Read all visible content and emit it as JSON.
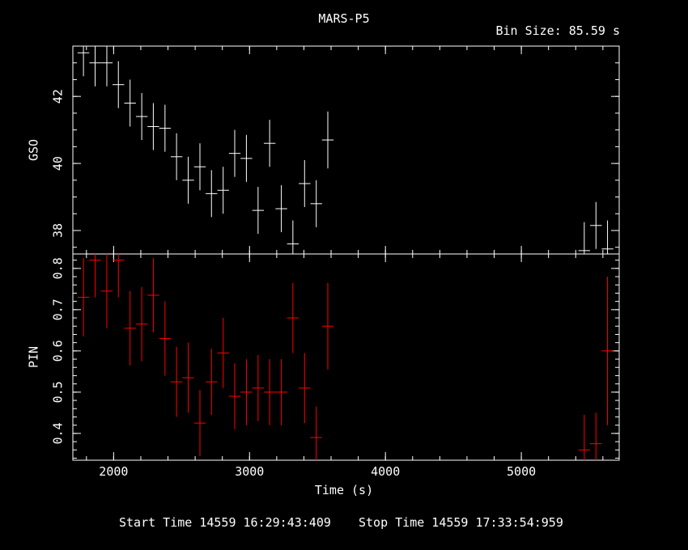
{
  "title": "MARS-P5",
  "bin_size": "Bin Size: 85.59 s",
  "start_time": "Start Time 14559 16:29:43:409",
  "stop_time": "Stop Time 14559 17:33:54:959",
  "colors": {
    "background": "#000000",
    "axes": "#ffffff",
    "gso": "#ffffff",
    "pin": "#ff0000"
  },
  "chart_data": [
    {
      "type": "scatter",
      "panel": "top",
      "ylabel": "GSO",
      "xlim": [
        1700,
        5720
      ],
      "ylim": [
        37.3,
        43.5
      ],
      "yticks": [
        38,
        40,
        42
      ],
      "ytick_labels": [
        "38",
        "40",
        "42"
      ],
      "minor_ystep": 0.5,
      "x_halfwidth": 42.8,
      "series": [
        {
          "color": "#ffffff",
          "points": [
            [
              1778,
              43.3,
              0.7
            ],
            [
              1864,
              43.0,
              0.7
            ],
            [
              1950,
              43.0,
              0.7
            ],
            [
              2035,
              42.35,
              0.7
            ],
            [
              2121,
              41.8,
              0.7
            ],
            [
              2207,
              41.4,
              0.7
            ],
            [
              2292,
              41.1,
              0.7
            ],
            [
              2378,
              41.05,
              0.7
            ],
            [
              2463,
              40.2,
              0.7
            ],
            [
              2549,
              39.5,
              0.7
            ],
            [
              2635,
              39.9,
              0.7
            ],
            [
              2720,
              39.1,
              0.7
            ],
            [
              2806,
              39.2,
              0.7
            ],
            [
              2891,
              40.3,
              0.7
            ],
            [
              2977,
              40.15,
              0.7
            ],
            [
              3063,
              38.6,
              0.7
            ],
            [
              3148,
              40.6,
              0.7
            ],
            [
              3234,
              38.65,
              0.7
            ],
            [
              3319,
              37.6,
              0.7
            ],
            [
              3405,
              39.4,
              0.7
            ],
            [
              3491,
              38.8,
              0.7
            ],
            [
              3576,
              40.7,
              0.85
            ],
            [
              5463,
              37.4,
              0.85
            ],
            [
              5549,
              38.15,
              0.7
            ],
            [
              5634,
              37.45,
              0.85
            ]
          ]
        }
      ]
    },
    {
      "type": "scatter",
      "panel": "bottom",
      "ylabel": "PIN",
      "xlabel": "Time (s)",
      "xlim": [
        1700,
        5720
      ],
      "ylim": [
        0.335,
        0.835
      ],
      "yticks": [
        0.4,
        0.5,
        0.6,
        0.7,
        0.8
      ],
      "ytick_labels": [
        "0.4",
        "0.5",
        "0.6",
        "0.7",
        "0.8"
      ],
      "minor_ystep": 0.02,
      "xticks": [
        2000,
        3000,
        4000,
        5000
      ],
      "xtick_labels": [
        "2000",
        "3000",
        "4000",
        "5000"
      ],
      "minor_xstep": 200,
      "x_halfwidth": 42.8,
      "series": [
        {
          "color": "#ff0000",
          "points": [
            [
              1778,
              0.73,
              0.095
            ],
            [
              1864,
              0.82,
              0.09
            ],
            [
              1950,
              0.745,
              0.09
            ],
            [
              2035,
              0.82,
              0.09
            ],
            [
              2121,
              0.655,
              0.09
            ],
            [
              2207,
              0.665,
              0.09
            ],
            [
              2292,
              0.735,
              0.09
            ],
            [
              2378,
              0.63,
              0.09
            ],
            [
              2463,
              0.525,
              0.085
            ],
            [
              2549,
              0.535,
              0.085
            ],
            [
              2635,
              0.425,
              0.08
            ],
            [
              2720,
              0.525,
              0.08
            ],
            [
              2806,
              0.595,
              0.085
            ],
            [
              2891,
              0.49,
              0.08
            ],
            [
              2977,
              0.5,
              0.08
            ],
            [
              3063,
              0.51,
              0.08
            ],
            [
              3148,
              0.5,
              0.08
            ],
            [
              3234,
              0.5,
              0.08
            ],
            [
              3319,
              0.68,
              0.085
            ],
            [
              3405,
              0.51,
              0.085
            ],
            [
              3491,
              0.39,
              0.075
            ],
            [
              3576,
              0.66,
              0.105
            ],
            [
              5463,
              0.36,
              0.085
            ],
            [
              5549,
              0.375,
              0.075
            ],
            [
              5634,
              0.6,
              0.18
            ]
          ]
        }
      ]
    }
  ]
}
